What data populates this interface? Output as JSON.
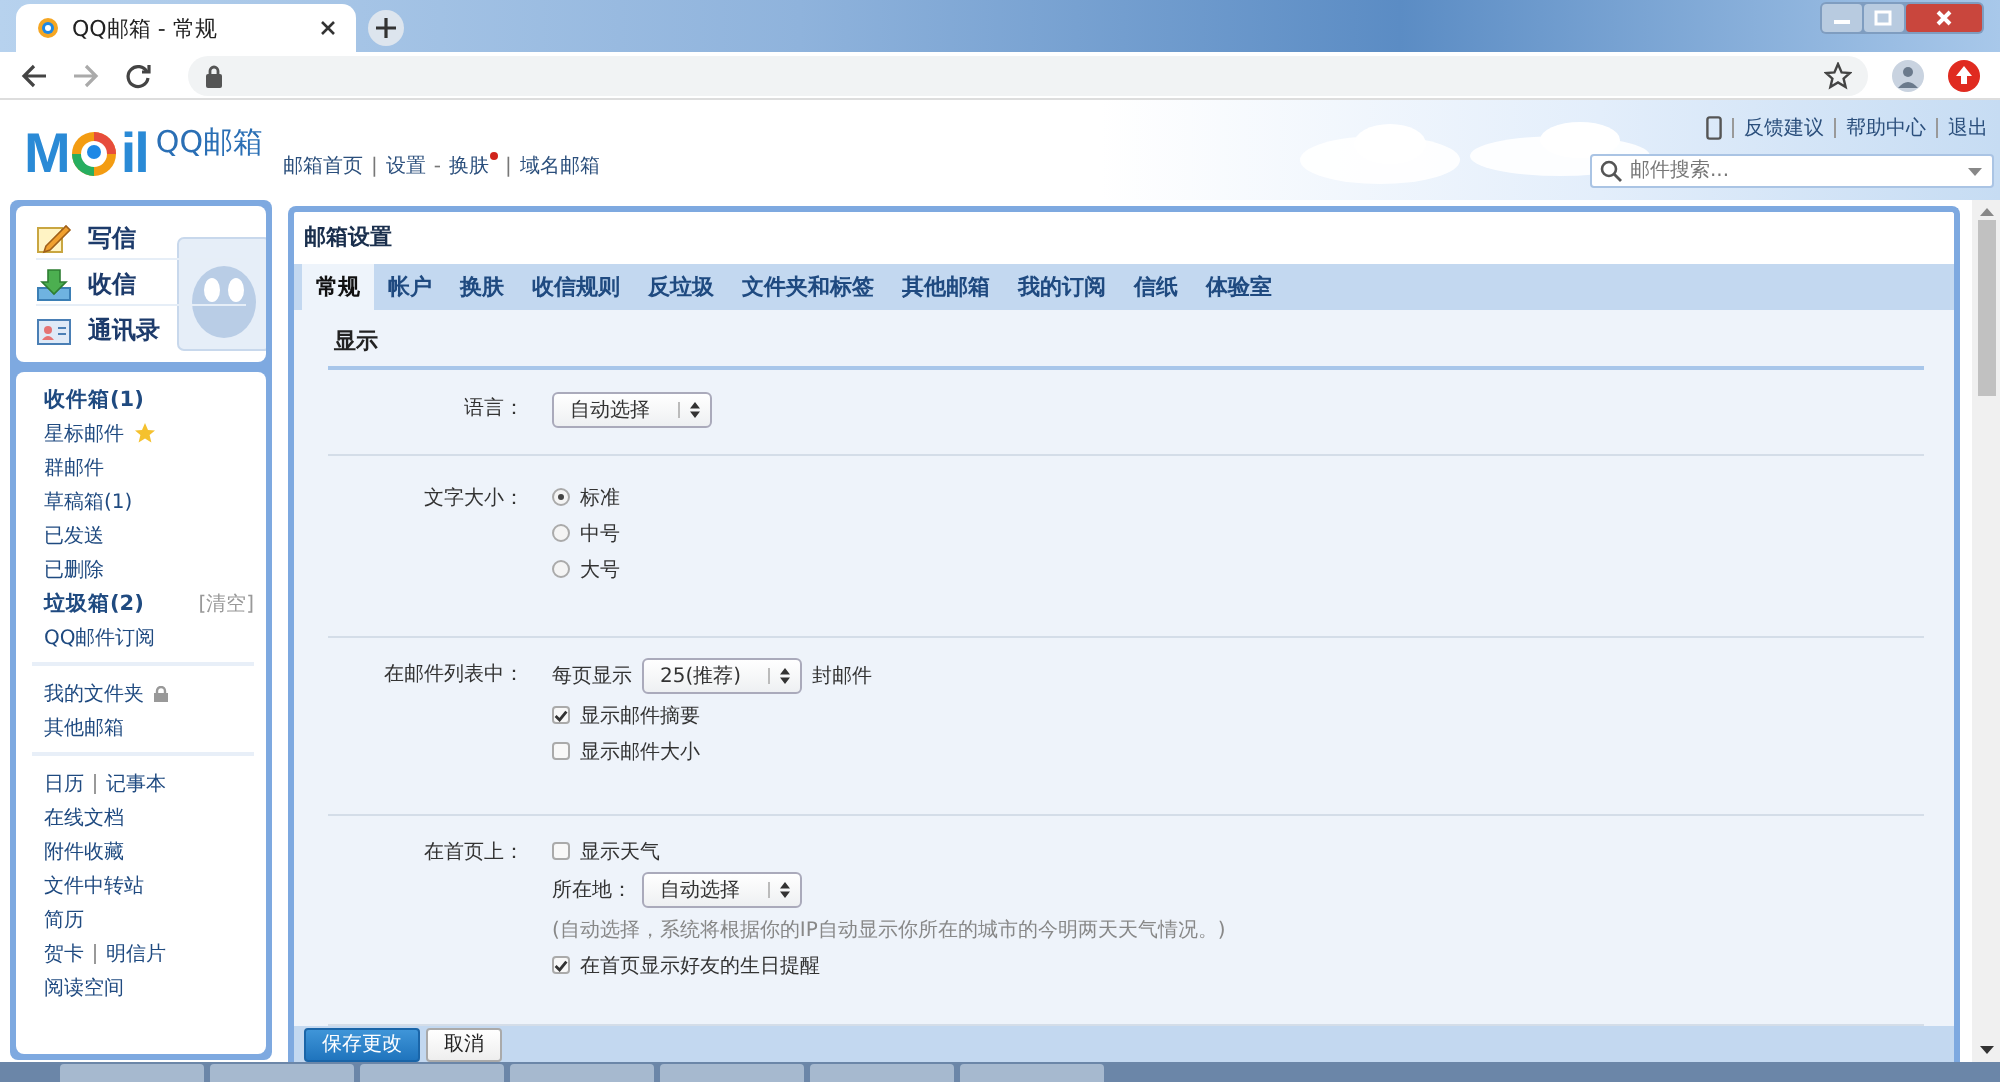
{
  "browser": {
    "tab_title": "QQ邮箱 - 常规"
  },
  "header": {
    "logo": {
      "before": "M",
      "after": "il",
      "product": "QQ邮箱"
    },
    "nav": [
      {
        "text": "邮箱首页",
        "sep_after": "|",
        "dot": false
      },
      {
        "text": "设置",
        "sep_after": "-",
        "dot": false
      },
      {
        "text": "换肤",
        "sep_after": "|",
        "dot": true
      },
      {
        "text": "域名邮箱",
        "dot": false
      }
    ],
    "top_links": [
      "反馈建议",
      "帮助中心",
      "退出"
    ],
    "search": {
      "placeholder": "邮件搜索..."
    }
  },
  "sidebar": {
    "actions": [
      {
        "label": "写信",
        "kind": "write"
      },
      {
        "label": "收信",
        "kind": "receive"
      },
      {
        "label": "通讯录",
        "kind": "contacts"
      }
    ],
    "groups": [
      [
        {
          "items": [
            {
              "text": "收件箱(1)",
              "bold": true
            }
          ]
        },
        {
          "items": [
            {
              "text": "星标邮件",
              "bold": false
            }
          ],
          "kind": "star"
        },
        {
          "items": [
            {
              "text": "群邮件",
              "bold": false
            }
          ]
        },
        {
          "items": [
            {
              "text": "草稿箱(1)",
              "bold": false
            }
          ]
        },
        {
          "items": [
            {
              "text": "已发送",
              "bold": false
            }
          ]
        },
        {
          "items": [
            {
              "text": "已删除",
              "bold": false
            }
          ]
        },
        {
          "items": [
            {
              "text": "垃圾箱(2)",
              "bold": true
            }
          ],
          "action": "[清空]"
        },
        {
          "items": [
            {
              "text": "QQ邮件订阅",
              "bold": false
            }
          ]
        }
      ],
      [
        {
          "items": [
            {
              "text": "我的文件夹",
              "bold": false
            }
          ],
          "kind": "lock"
        },
        {
          "items": [
            {
              "text": "其他邮箱",
              "bold": false
            }
          ]
        }
      ],
      [
        {
          "items": [
            {
              "text": "日历",
              "bold": false
            },
            {
              "text": "记事本",
              "bold": false
            }
          ]
        },
        {
          "items": [
            {
              "text": "在线文档",
              "bold": false
            }
          ]
        },
        {
          "items": [
            {
              "text": "附件收藏",
              "bold": false
            }
          ]
        },
        {
          "items": [
            {
              "text": "文件中转站",
              "bold": false
            }
          ]
        },
        {
          "items": [
            {
              "text": "简历",
              "bold": false
            }
          ]
        },
        {
          "items": [
            {
              "text": "贺卡",
              "bold": false
            },
            {
              "text": "明信片",
              "bold": false
            }
          ]
        },
        {
          "items": [
            {
              "text": "阅读空间",
              "bold": false
            }
          ]
        }
      ]
    ]
  },
  "settings": {
    "title": "邮箱设置",
    "tabs": [
      {
        "label": "常规",
        "selected": true
      },
      {
        "label": "帐户",
        "selected": false
      },
      {
        "label": "换肤",
        "selected": false
      },
      {
        "label": "收信规则",
        "selected": false
      },
      {
        "label": "反垃圾",
        "selected": false
      },
      {
        "label": "文件夹和标签",
        "selected": false
      },
      {
        "label": "其他邮箱",
        "selected": false
      },
      {
        "label": "我的订阅",
        "selected": false
      },
      {
        "label": "信纸",
        "selected": false
      },
      {
        "label": "体验室",
        "selected": false
      }
    ],
    "section": "显示",
    "rows": [
      {
        "label": "语言：",
        "controls": [
          {
            "kind": "select",
            "value": "自动选择"
          }
        ]
      },
      {
        "label": "文字大小：",
        "controls": [
          {
            "kind": "radio",
            "text": "标准",
            "selected": true
          },
          {
            "kind": "radio",
            "text": "中号",
            "selected": false
          },
          {
            "kind": "radio",
            "text": "大号",
            "selected": false
          }
        ]
      },
      {
        "label": "在邮件列表中：",
        "controls": [
          {
            "kind": "select",
            "prefix": "每页显示",
            "value": "25(推荐)",
            "suffix": "封邮件"
          },
          {
            "kind": "checkbox",
            "text": "显示邮件摘要",
            "checked": true
          },
          {
            "kind": "checkbox",
            "text": "显示邮件大小",
            "checked": false
          }
        ]
      },
      {
        "label": "在首页上：",
        "controls": [
          {
            "kind": "checkbox",
            "text": "显示天气",
            "checked": false
          },
          {
            "kind": "select",
            "prefix": "所在地：",
            "value": "自动选择"
          },
          {
            "kind": "note",
            "text": "(自动选择，系统将根据你的IP自动显示你所在的城市的今明两天天气情况。)"
          },
          {
            "kind": "checkbox",
            "text": "在首页显示好友的生日提醒",
            "checked": true
          }
        ]
      }
    ],
    "buttons": [
      {
        "label": "保存更改",
        "kind": "primary"
      },
      {
        "label": "取消",
        "kind": "plain"
      }
    ]
  }
}
